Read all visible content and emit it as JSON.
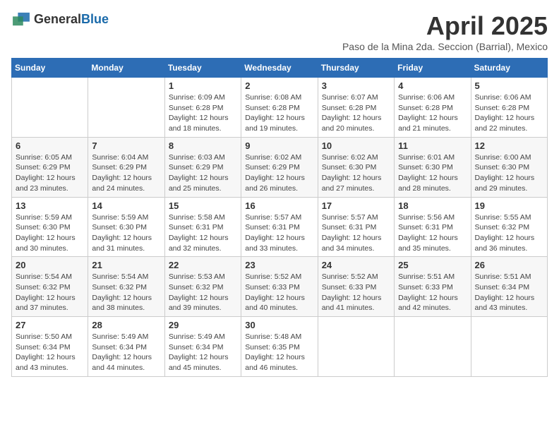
{
  "logo": {
    "general": "General",
    "blue": "Blue"
  },
  "title": "April 2025",
  "subtitle": "Paso de la Mina 2da. Seccion (Barrial), Mexico",
  "days_of_week": [
    "Sunday",
    "Monday",
    "Tuesday",
    "Wednesday",
    "Thursday",
    "Friday",
    "Saturday"
  ],
  "weeks": [
    [
      {
        "day": "",
        "info": ""
      },
      {
        "day": "",
        "info": ""
      },
      {
        "day": "1",
        "info": "Sunrise: 6:09 AM\nSunset: 6:28 PM\nDaylight: 12 hours and 18 minutes."
      },
      {
        "day": "2",
        "info": "Sunrise: 6:08 AM\nSunset: 6:28 PM\nDaylight: 12 hours and 19 minutes."
      },
      {
        "day": "3",
        "info": "Sunrise: 6:07 AM\nSunset: 6:28 PM\nDaylight: 12 hours and 20 minutes."
      },
      {
        "day": "4",
        "info": "Sunrise: 6:06 AM\nSunset: 6:28 PM\nDaylight: 12 hours and 21 minutes."
      },
      {
        "day": "5",
        "info": "Sunrise: 6:06 AM\nSunset: 6:28 PM\nDaylight: 12 hours and 22 minutes."
      }
    ],
    [
      {
        "day": "6",
        "info": "Sunrise: 6:05 AM\nSunset: 6:29 PM\nDaylight: 12 hours and 23 minutes."
      },
      {
        "day": "7",
        "info": "Sunrise: 6:04 AM\nSunset: 6:29 PM\nDaylight: 12 hours and 24 minutes."
      },
      {
        "day": "8",
        "info": "Sunrise: 6:03 AM\nSunset: 6:29 PM\nDaylight: 12 hours and 25 minutes."
      },
      {
        "day": "9",
        "info": "Sunrise: 6:02 AM\nSunset: 6:29 PM\nDaylight: 12 hours and 26 minutes."
      },
      {
        "day": "10",
        "info": "Sunrise: 6:02 AM\nSunset: 6:30 PM\nDaylight: 12 hours and 27 minutes."
      },
      {
        "day": "11",
        "info": "Sunrise: 6:01 AM\nSunset: 6:30 PM\nDaylight: 12 hours and 28 minutes."
      },
      {
        "day": "12",
        "info": "Sunrise: 6:00 AM\nSunset: 6:30 PM\nDaylight: 12 hours and 29 minutes."
      }
    ],
    [
      {
        "day": "13",
        "info": "Sunrise: 5:59 AM\nSunset: 6:30 PM\nDaylight: 12 hours and 30 minutes."
      },
      {
        "day": "14",
        "info": "Sunrise: 5:59 AM\nSunset: 6:30 PM\nDaylight: 12 hours and 31 minutes."
      },
      {
        "day": "15",
        "info": "Sunrise: 5:58 AM\nSunset: 6:31 PM\nDaylight: 12 hours and 32 minutes."
      },
      {
        "day": "16",
        "info": "Sunrise: 5:57 AM\nSunset: 6:31 PM\nDaylight: 12 hours and 33 minutes."
      },
      {
        "day": "17",
        "info": "Sunrise: 5:57 AM\nSunset: 6:31 PM\nDaylight: 12 hours and 34 minutes."
      },
      {
        "day": "18",
        "info": "Sunrise: 5:56 AM\nSunset: 6:31 PM\nDaylight: 12 hours and 35 minutes."
      },
      {
        "day": "19",
        "info": "Sunrise: 5:55 AM\nSunset: 6:32 PM\nDaylight: 12 hours and 36 minutes."
      }
    ],
    [
      {
        "day": "20",
        "info": "Sunrise: 5:54 AM\nSunset: 6:32 PM\nDaylight: 12 hours and 37 minutes."
      },
      {
        "day": "21",
        "info": "Sunrise: 5:54 AM\nSunset: 6:32 PM\nDaylight: 12 hours and 38 minutes."
      },
      {
        "day": "22",
        "info": "Sunrise: 5:53 AM\nSunset: 6:32 PM\nDaylight: 12 hours and 39 minutes."
      },
      {
        "day": "23",
        "info": "Sunrise: 5:52 AM\nSunset: 6:33 PM\nDaylight: 12 hours and 40 minutes."
      },
      {
        "day": "24",
        "info": "Sunrise: 5:52 AM\nSunset: 6:33 PM\nDaylight: 12 hours and 41 minutes."
      },
      {
        "day": "25",
        "info": "Sunrise: 5:51 AM\nSunset: 6:33 PM\nDaylight: 12 hours and 42 minutes."
      },
      {
        "day": "26",
        "info": "Sunrise: 5:51 AM\nSunset: 6:34 PM\nDaylight: 12 hours and 43 minutes."
      }
    ],
    [
      {
        "day": "27",
        "info": "Sunrise: 5:50 AM\nSunset: 6:34 PM\nDaylight: 12 hours and 43 minutes."
      },
      {
        "day": "28",
        "info": "Sunrise: 5:49 AM\nSunset: 6:34 PM\nDaylight: 12 hours and 44 minutes."
      },
      {
        "day": "29",
        "info": "Sunrise: 5:49 AM\nSunset: 6:34 PM\nDaylight: 12 hours and 45 minutes."
      },
      {
        "day": "30",
        "info": "Sunrise: 5:48 AM\nSunset: 6:35 PM\nDaylight: 12 hours and 46 minutes."
      },
      {
        "day": "",
        "info": ""
      },
      {
        "day": "",
        "info": ""
      },
      {
        "day": "",
        "info": ""
      }
    ]
  ]
}
